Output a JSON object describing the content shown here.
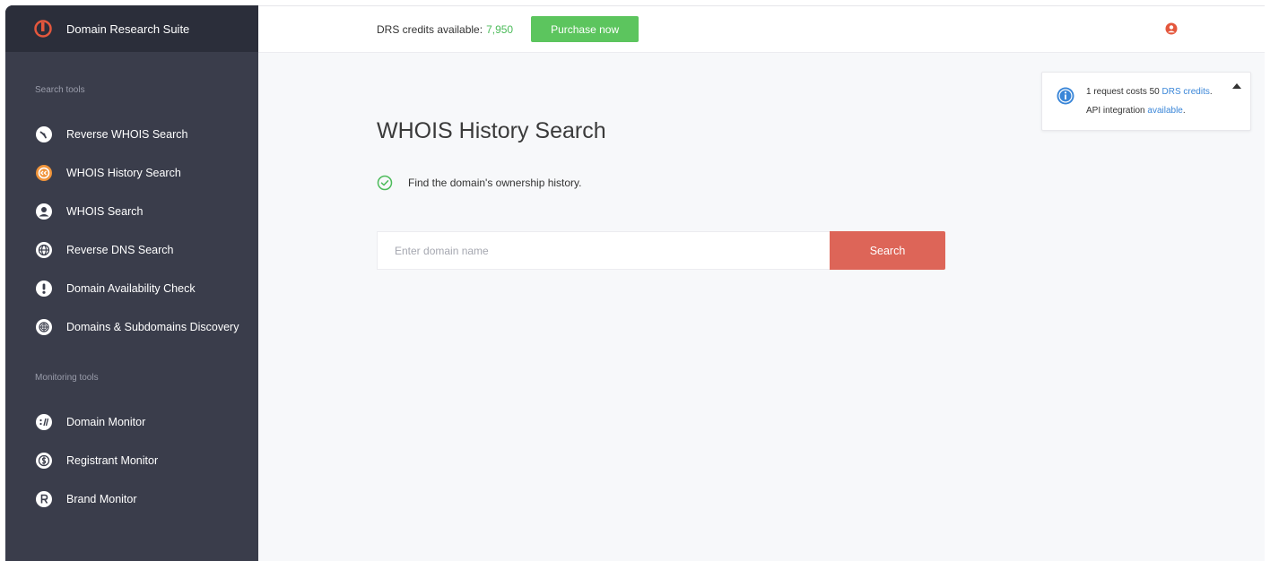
{
  "app": {
    "name": "Domain Research Suite",
    "brand_color": "#e4573d"
  },
  "sidebar": {
    "search_section_label": "Search tools",
    "search_items": [
      {
        "label": "Reverse WHOIS Search",
        "icon": "reverse-whois-icon",
        "active": false
      },
      {
        "label": "WHOIS History Search",
        "icon": "history-icon",
        "active": true
      },
      {
        "label": "WHOIS Search",
        "icon": "user-circle-icon",
        "active": false
      },
      {
        "label": "Reverse DNS Search",
        "icon": "globe-icon",
        "active": false
      },
      {
        "label": "Domain Availability Check",
        "icon": "alert-icon",
        "active": false
      },
      {
        "label": "Domains & Subdomains Discovery",
        "icon": "discovery-icon",
        "active": false
      }
    ],
    "monitoring_section_label": "Monitoring tools",
    "monitoring_items": [
      {
        "label": "Domain Monitor",
        "icon": "domain-monitor-icon"
      },
      {
        "label": "Registrant Monitor",
        "icon": "registrant-monitor-icon"
      },
      {
        "label": "Brand Monitor",
        "icon": "brand-monitor-icon"
      }
    ]
  },
  "topbar": {
    "credits_label": "DRS credits available:",
    "credits_value": "7,950",
    "purchase_label": "Purchase now",
    "purchase_color": "#5cc55e"
  },
  "main": {
    "title": "WHOIS History Search",
    "subtitle": "Find the domain's ownership history.",
    "search": {
      "placeholder": "Enter domain name",
      "value": "",
      "button_label": "Search",
      "button_color": "#dd6558"
    }
  },
  "info": {
    "line1_prefix": "1 request costs 50",
    "line1_link": "DRS credits",
    "line1_suffix": ".",
    "line2_prefix": "API integration",
    "line2_link": "available",
    "line2_suffix": "."
  }
}
